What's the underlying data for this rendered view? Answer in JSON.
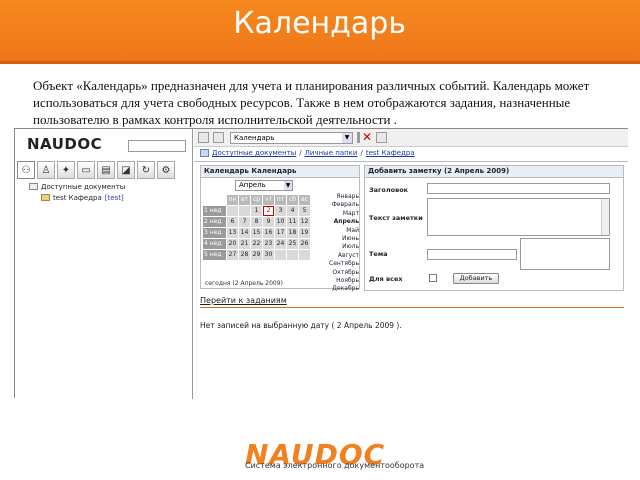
{
  "header": {
    "title": "Календарь",
    "colors": {
      "bg": "#f58a1f",
      "text": "#ffffff"
    }
  },
  "description": "Объект «Календарь» предназначен для учета и планирования различных событий. Календарь может использоваться для учета свободных ресурсов. Также в нем отображаются задания, назначенные пользователю в рамках контроля исполнительской деятельности .",
  "app": {
    "logo": {
      "text": "NAUDOC"
    },
    "left_toolbar_icons": [
      "tree-icon",
      "person-icon",
      "workflow-icon",
      "folder-icon",
      "documents-icon",
      "bookmark-icon",
      "refresh-icon",
      "settings-icon"
    ],
    "tree": {
      "root": "Доступные документы",
      "child_label": "test Кафедра",
      "child_tag": "[test]"
    },
    "toolbar": {
      "select_value": "Календарь",
      "close_glyph": "✕"
    },
    "breadcrumb": {
      "items": [
        "Доступные документы",
        "Личные папки",
        "test Кафедра"
      ],
      "separator": "/"
    },
    "calendar": {
      "title": "Календарь Календарь",
      "month_select": "Апрель",
      "day_headers": [
        "пн",
        "вт",
        "ср",
        "чт",
        "пт",
        "сб",
        "вс"
      ],
      "weeks": [
        {
          "label": "1 нед",
          "days": [
            "",
            "",
            "1",
            "2",
            "3",
            "4",
            "5"
          ]
        },
        {
          "label": "2 нед",
          "days": [
            "6",
            "7",
            "8",
            "9",
            "10",
            "11",
            "12"
          ]
        },
        {
          "label": "3 нед",
          "days": [
            "13",
            "14",
            "15",
            "16",
            "17",
            "18",
            "19"
          ]
        },
        {
          "label": "4 нед",
          "days": [
            "20",
            "21",
            "22",
            "23",
            "24",
            "25",
            "26"
          ]
        },
        {
          "label": "5 нед",
          "days": [
            "27",
            "28",
            "29",
            "30",
            "",
            "",
            ""
          ]
        }
      ],
      "today_day": "2",
      "months": [
        "Январь",
        "Февраль",
        "Март",
        "Апрель",
        "Май",
        "Июнь",
        "Июль",
        "Август",
        "Сентябрь",
        "Октябрь",
        "Ноябрь",
        "Декабрь"
      ],
      "current_month": "Апрель",
      "today_text": "сегодня (2 Апрель 2009)"
    },
    "note_form": {
      "title": "Добавить заметку (2 Апрель 2009)",
      "heading_label": "Заголовок",
      "text_label": "Текст заметки",
      "theme_label": "Тема",
      "for_all_label": "Для всех",
      "add_button": "Добавить"
    },
    "goto_tasks": "Перейти к заданиям",
    "no_records": "Нет записей на выбранную дату ( 2 Апрель 2009 )."
  },
  "footer": {
    "logo": "NAUDOC",
    "subtitle": "Система электронного документооборота",
    "accent": "#f08020"
  }
}
